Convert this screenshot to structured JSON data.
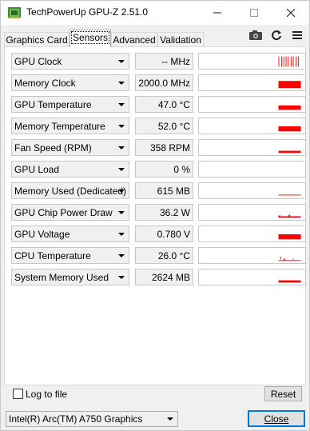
{
  "window": {
    "title": "TechPowerUp GPU-Z 2.51.0"
  },
  "tabs": [
    {
      "label": "Graphics Card",
      "active": false
    },
    {
      "label": "Sensors",
      "active": true
    },
    {
      "label": "Advanced",
      "active": false
    },
    {
      "label": "Validation",
      "active": false
    }
  ],
  "toolbar": {
    "icons": [
      "camera-icon",
      "refresh-icon",
      "menu-icon"
    ]
  },
  "sensors": [
    {
      "name": "GPU Clock",
      "value": "-- MHz"
    },
    {
      "name": "Memory Clock",
      "value": "2000.0 MHz"
    },
    {
      "name": "GPU Temperature",
      "value": "47.0 °C"
    },
    {
      "name": "Memory Temperature",
      "value": "52.0 °C"
    },
    {
      "name": "Fan Speed (RPM)",
      "value": "358 RPM"
    },
    {
      "name": "GPU Load",
      "value": "0 %"
    },
    {
      "name": "Memory Used (Dedicated)",
      "value": "615 MB"
    },
    {
      "name": "GPU Chip Power Draw",
      "value": "36.2 W"
    },
    {
      "name": "GPU Voltage",
      "value": "0.780 V"
    },
    {
      "name": "CPU Temperature",
      "value": "26.0 °C"
    },
    {
      "name": "System Memory Used",
      "value": "2624 MB"
    }
  ],
  "footer": {
    "log_label": "Log to file",
    "log_checked": false,
    "reset_label": "Reset",
    "device": "Intel(R) Arc(TM) A750 Graphics",
    "close_label": "Close"
  },
  "colors": {
    "graph": "#ff0000",
    "accent": "#0078d7"
  }
}
